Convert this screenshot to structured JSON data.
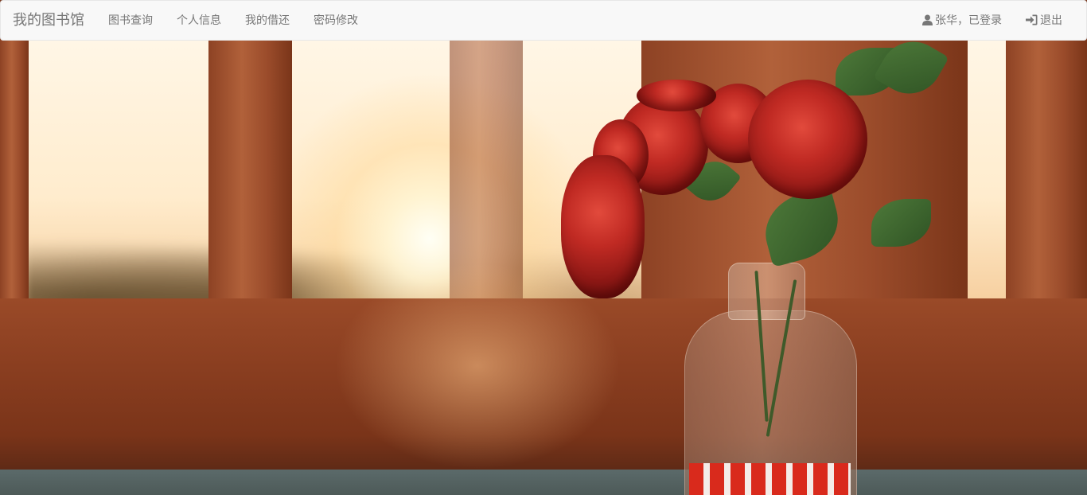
{
  "navbar": {
    "brand": "我的图书馆",
    "menu": [
      {
        "label": "图书查询"
      },
      {
        "label": "个人信息"
      },
      {
        "label": "我的借还"
      },
      {
        "label": "密码修改"
      }
    ],
    "user": {
      "icon": "user-icon",
      "label": "张华，已登录"
    },
    "logout": {
      "icon": "log-in-icon",
      "label": "退出"
    }
  },
  "colors": {
    "navbar_bg": "#f8f8f8",
    "nav_text": "#777777"
  }
}
